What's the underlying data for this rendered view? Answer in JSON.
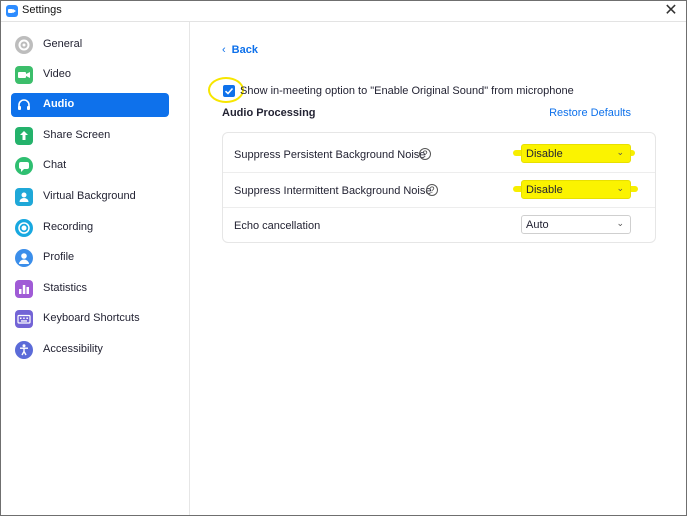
{
  "window": {
    "title": "Settings"
  },
  "sidebar": {
    "items": [
      {
        "label": "General",
        "icon": "gear-icon",
        "color": "#9b9b9b",
        "active": false
      },
      {
        "label": "Video",
        "icon": "video-camera-icon",
        "color": "#3cbe6b",
        "active": false
      },
      {
        "label": "Audio",
        "icon": "headphones-icon",
        "color": "#0e71eb",
        "active": true
      },
      {
        "label": "Share Screen",
        "icon": "share-screen-icon",
        "color": "#24b26b",
        "active": false
      },
      {
        "label": "Chat",
        "icon": "chat-bubble-icon",
        "color": "#2fbf71",
        "active": false
      },
      {
        "label": "Virtual Background",
        "icon": "person-background-icon",
        "color": "#1fa8d8",
        "active": false
      },
      {
        "label": "Recording",
        "icon": "record-icon",
        "color": "#18a8e0",
        "active": false
      },
      {
        "label": "Profile",
        "icon": "person-icon",
        "color": "#3b8eea",
        "active": false
      },
      {
        "label": "Statistics",
        "icon": "bar-chart-icon",
        "color": "#a05bd6",
        "active": false
      },
      {
        "label": "Keyboard Shortcuts",
        "icon": "keyboard-icon",
        "color": "#7364d6",
        "active": false
      },
      {
        "label": "Accessibility",
        "icon": "accessibility-icon",
        "color": "#5b6bd8",
        "active": false
      }
    ]
  },
  "main": {
    "back_label": "Back",
    "original_sound_label": "Show in-meeting option to \"Enable Original Sound\" from microphone",
    "original_sound_checked": true,
    "section_title": "Audio Processing",
    "restore_label": "Restore Defaults",
    "rows": [
      {
        "label": "Suppress Persistent Background Noise",
        "value": "Disable",
        "help": "?"
      },
      {
        "label": "Suppress Intermittent Background Noise",
        "value": "Disable",
        "help": "?"
      },
      {
        "label": "Echo cancellation",
        "value": "Auto"
      }
    ]
  },
  "colors": {
    "accent": "#0e71eb",
    "highlight": "#f7ee00"
  }
}
